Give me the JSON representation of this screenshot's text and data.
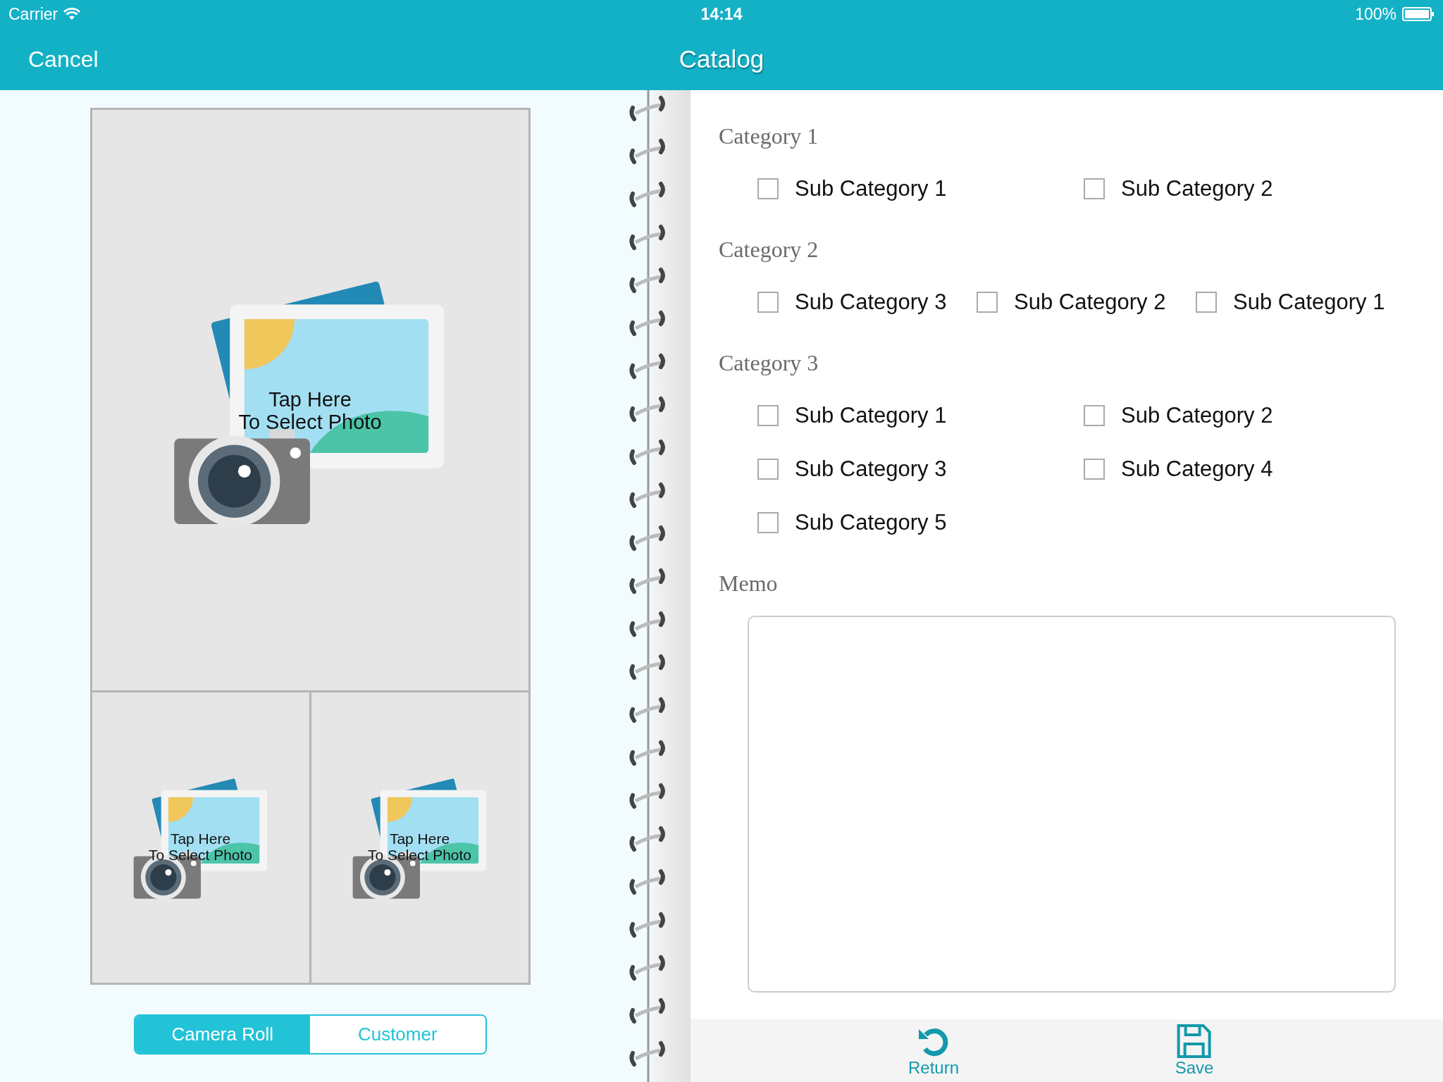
{
  "status_bar": {
    "carrier": "Carrier",
    "time": "14:14",
    "battery": "100%"
  },
  "nav_bar": {
    "left_button": "Cancel",
    "title": "Catalog"
  },
  "photo_slots": [
    {
      "hint": "Tap Here\nTo Select Photo"
    },
    {
      "hint": "Tap Here\nTo Select Photo"
    },
    {
      "hint": "Tap Here\nTo Select Photo"
    }
  ],
  "source_tabs": [
    {
      "label": "Camera Roll",
      "selected": true
    },
    {
      "label": "Customer",
      "selected": false
    }
  ],
  "categories": [
    {
      "title": "Category 1",
      "items": [
        {
          "label": "Sub Category 1",
          "checked": false
        },
        {
          "label": "Sub Category 2",
          "checked": false
        }
      ]
    },
    {
      "title": "Category 2",
      "items": [
        {
          "label": "Sub Category 3",
          "checked": false
        },
        {
          "label": "Sub Category 2",
          "checked": false
        },
        {
          "label": "Sub Category 1",
          "checked": false
        }
      ]
    },
    {
      "title": "Category 3",
      "items": [
        {
          "label": "Sub Category 1",
          "checked": false
        },
        {
          "label": "Sub Category 2",
          "checked": false
        },
        {
          "label": "Sub Category 3",
          "checked": false
        },
        {
          "label": "Sub Category 4",
          "checked": false
        },
        {
          "label": "Sub Category 5",
          "checked": false
        }
      ]
    }
  ],
  "memo": {
    "label": "Memo"
  },
  "toolbar": [
    {
      "kind": "return",
      "label": "Return"
    },
    {
      "kind": "save",
      "label": "Save"
    }
  ]
}
